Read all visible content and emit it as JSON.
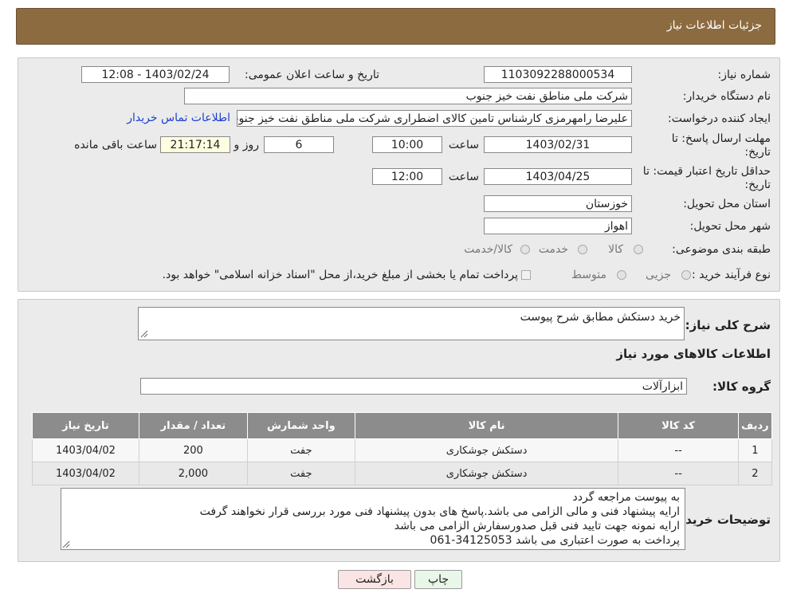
{
  "header": {
    "title": "جزئیات اطلاعات نیاز"
  },
  "need": {
    "number_label": "شماره نیاز:",
    "number": "1103092288000534",
    "announce_label": "تاریخ و ساعت اعلان عمومی:",
    "announce_value": "1403/02/24 - 12:08",
    "buyer_label": "نام دستگاه خریدار:",
    "buyer": "شرکت ملی مناطق نفت خیز جنوب",
    "creator_label": "ایجاد کننده درخواست:",
    "creator": "علیرضا رامهرمزی کارشناس تامین کالای اضطراری شرکت ملی مناطق نفت خیز جنوب",
    "contact_link": "اطلاعات تماس خریدار",
    "deadline_label_1": "مهلت ارسال پاسخ: تا",
    "deadline_label_2": "تاریخ:",
    "deadline_date": "1403/02/31",
    "time_label": "ساعت",
    "deadline_time": "10:00",
    "days": "6",
    "days_label": "روز و",
    "remaining": "21:17:14",
    "remaining_label": "ساعت باقی مانده",
    "validity_label_1": "حداقل تاریخ اعتبار قیمت: تا",
    "validity_label_2": "تاریخ:",
    "validity_date": "1403/04/25",
    "validity_time": "12:00",
    "province_label": "استان محل تحویل:",
    "province": "خوزستان",
    "city_label": "شهر محل تحویل:",
    "city": "اهواز",
    "category_label": "طبقه بندی موضوعی:",
    "category_options": [
      "کالا",
      "خدمت",
      "کالا/خدمت"
    ],
    "process_label": "نوع فرآیند خرید :",
    "process_options": [
      "جزیی",
      "متوسط"
    ],
    "payment_note": "پرداخت تمام یا بخشی از مبلغ خرید،از محل \"اسناد خزانه اسلامی\" خواهد بود."
  },
  "description": {
    "label": "شرح کلی نیاز:",
    "value": "خرید دستکش مطابق شرح پیوست"
  },
  "goods": {
    "section_title": "اطلاعات کالاهای مورد نیاز",
    "group_label": "گروه کالا:",
    "group_value": "ابزارآلات",
    "columns": [
      "ردیف",
      "کد کالا",
      "نام کالا",
      "واحد شمارش",
      "تعداد / مقدار",
      "تاریخ نیاز"
    ],
    "rows": [
      [
        "1",
        "--",
        "دستکش جوشکاری",
        "جفت",
        "200",
        "1403/04/02"
      ],
      [
        "2",
        "--",
        "دستکش جوشکاری",
        "جفت",
        "2,000",
        "1403/04/02"
      ]
    ]
  },
  "buyer_notes": {
    "label": "توضیحات خریدار:",
    "lines": [
      "به پیوست مراجعه گردد",
      "ارایه پیشنهاد فنی و مالی الزامی می باشد.پاسخ های بدون پیشنهاد فنی مورد بررسی قرار نخواهند گرفت",
      "ارایه نمونه جهت تایید فنی قبل صدورسفارش الزامی می باشد",
      "پرداخت به صورت اعتباری می باشد 34125053-061"
    ]
  },
  "buttons": {
    "print": "چاپ",
    "back": "بازگشت"
  },
  "colors": {
    "header": "#8c6b40",
    "table_header": "#8c8c8c",
    "print_btn": "#e8f7e8",
    "back_btn": "#fbe4e4",
    "link": "#1a3fd1"
  }
}
